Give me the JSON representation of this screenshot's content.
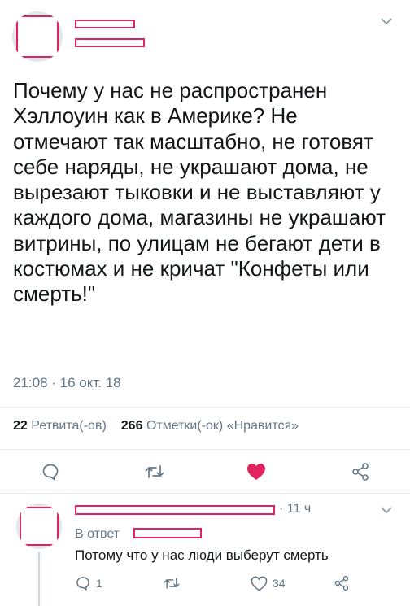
{
  "tweet": {
    "text": "Почему у нас не распространен Хэллоуин как в Америке? Не отмечают так масштабно, не готовят себе наряды, не украшают дома, не вырезают тыковки и не выставляют у каждого дома, магазины не украшают витрины, по улицам не бегают дети в костюмах и не кричат \"Конфеты или смерть!\"",
    "timestamp": "21:08 · 16 окт. 18",
    "retweets_count": "22",
    "retweets_label": "Ретвита(-ов)",
    "likes_count": "266",
    "likes_label": "Отметки(-ок) «Нравится»",
    "liked": true
  },
  "reply": {
    "time": "· 11 ч",
    "in_reply_prefix": "В ответ",
    "text": "Потому что у нас люди выберут смерть",
    "reply_count": "1",
    "retweet_count": "",
    "like_count": "34"
  },
  "colors": {
    "like_active": "#e0245e",
    "secondary_text": "#657786",
    "redaction": "#e0245e"
  }
}
